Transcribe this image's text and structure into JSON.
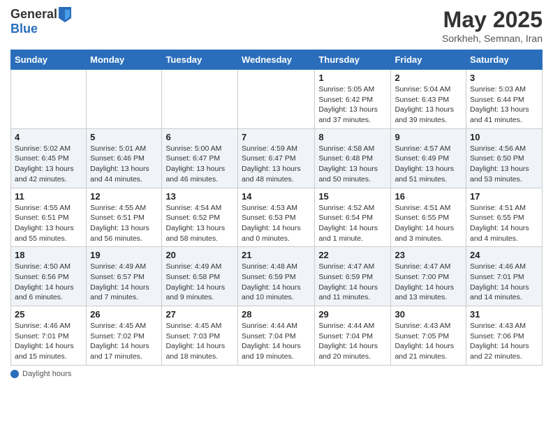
{
  "header": {
    "logo_line1": "General",
    "logo_line2": "Blue",
    "month": "May 2025",
    "location": "Sorkheh, Semnan, Iran"
  },
  "weekdays": [
    "Sunday",
    "Monday",
    "Tuesday",
    "Wednesday",
    "Thursday",
    "Friday",
    "Saturday"
  ],
  "weeks": [
    [
      {
        "day": "",
        "info": ""
      },
      {
        "day": "",
        "info": ""
      },
      {
        "day": "",
        "info": ""
      },
      {
        "day": "",
        "info": ""
      },
      {
        "day": "1",
        "info": "Sunrise: 5:05 AM\nSunset: 6:42 PM\nDaylight: 13 hours\nand 37 minutes."
      },
      {
        "day": "2",
        "info": "Sunrise: 5:04 AM\nSunset: 6:43 PM\nDaylight: 13 hours\nand 39 minutes."
      },
      {
        "day": "3",
        "info": "Sunrise: 5:03 AM\nSunset: 6:44 PM\nDaylight: 13 hours\nand 41 minutes."
      }
    ],
    [
      {
        "day": "4",
        "info": "Sunrise: 5:02 AM\nSunset: 6:45 PM\nDaylight: 13 hours\nand 42 minutes."
      },
      {
        "day": "5",
        "info": "Sunrise: 5:01 AM\nSunset: 6:46 PM\nDaylight: 13 hours\nand 44 minutes."
      },
      {
        "day": "6",
        "info": "Sunrise: 5:00 AM\nSunset: 6:47 PM\nDaylight: 13 hours\nand 46 minutes."
      },
      {
        "day": "7",
        "info": "Sunrise: 4:59 AM\nSunset: 6:47 PM\nDaylight: 13 hours\nand 48 minutes."
      },
      {
        "day": "8",
        "info": "Sunrise: 4:58 AM\nSunset: 6:48 PM\nDaylight: 13 hours\nand 50 minutes."
      },
      {
        "day": "9",
        "info": "Sunrise: 4:57 AM\nSunset: 6:49 PM\nDaylight: 13 hours\nand 51 minutes."
      },
      {
        "day": "10",
        "info": "Sunrise: 4:56 AM\nSunset: 6:50 PM\nDaylight: 13 hours\nand 53 minutes."
      }
    ],
    [
      {
        "day": "11",
        "info": "Sunrise: 4:55 AM\nSunset: 6:51 PM\nDaylight: 13 hours\nand 55 minutes."
      },
      {
        "day": "12",
        "info": "Sunrise: 4:55 AM\nSunset: 6:51 PM\nDaylight: 13 hours\nand 56 minutes."
      },
      {
        "day": "13",
        "info": "Sunrise: 4:54 AM\nSunset: 6:52 PM\nDaylight: 13 hours\nand 58 minutes."
      },
      {
        "day": "14",
        "info": "Sunrise: 4:53 AM\nSunset: 6:53 PM\nDaylight: 14 hours\nand 0 minutes."
      },
      {
        "day": "15",
        "info": "Sunrise: 4:52 AM\nSunset: 6:54 PM\nDaylight: 14 hours\nand 1 minute."
      },
      {
        "day": "16",
        "info": "Sunrise: 4:51 AM\nSunset: 6:55 PM\nDaylight: 14 hours\nand 3 minutes."
      },
      {
        "day": "17",
        "info": "Sunrise: 4:51 AM\nSunset: 6:55 PM\nDaylight: 14 hours\nand 4 minutes."
      }
    ],
    [
      {
        "day": "18",
        "info": "Sunrise: 4:50 AM\nSunset: 6:56 PM\nDaylight: 14 hours\nand 6 minutes."
      },
      {
        "day": "19",
        "info": "Sunrise: 4:49 AM\nSunset: 6:57 PM\nDaylight: 14 hours\nand 7 minutes."
      },
      {
        "day": "20",
        "info": "Sunrise: 4:49 AM\nSunset: 6:58 PM\nDaylight: 14 hours\nand 9 minutes."
      },
      {
        "day": "21",
        "info": "Sunrise: 4:48 AM\nSunset: 6:59 PM\nDaylight: 14 hours\nand 10 minutes."
      },
      {
        "day": "22",
        "info": "Sunrise: 4:47 AM\nSunset: 6:59 PM\nDaylight: 14 hours\nand 11 minutes."
      },
      {
        "day": "23",
        "info": "Sunrise: 4:47 AM\nSunset: 7:00 PM\nDaylight: 14 hours\nand 13 minutes."
      },
      {
        "day": "24",
        "info": "Sunrise: 4:46 AM\nSunset: 7:01 PM\nDaylight: 14 hours\nand 14 minutes."
      }
    ],
    [
      {
        "day": "25",
        "info": "Sunrise: 4:46 AM\nSunset: 7:01 PM\nDaylight: 14 hours\nand 15 minutes."
      },
      {
        "day": "26",
        "info": "Sunrise: 4:45 AM\nSunset: 7:02 PM\nDaylight: 14 hours\nand 17 minutes."
      },
      {
        "day": "27",
        "info": "Sunrise: 4:45 AM\nSunset: 7:03 PM\nDaylight: 14 hours\nand 18 minutes."
      },
      {
        "day": "28",
        "info": "Sunrise: 4:44 AM\nSunset: 7:04 PM\nDaylight: 14 hours\nand 19 minutes."
      },
      {
        "day": "29",
        "info": "Sunrise: 4:44 AM\nSunset: 7:04 PM\nDaylight: 14 hours\nand 20 minutes."
      },
      {
        "day": "30",
        "info": "Sunrise: 4:43 AM\nSunset: 7:05 PM\nDaylight: 14 hours\nand 21 minutes."
      },
      {
        "day": "31",
        "info": "Sunrise: 4:43 AM\nSunset: 7:06 PM\nDaylight: 14 hours\nand 22 minutes."
      }
    ]
  ],
  "footer": {
    "label": "Daylight hours"
  }
}
